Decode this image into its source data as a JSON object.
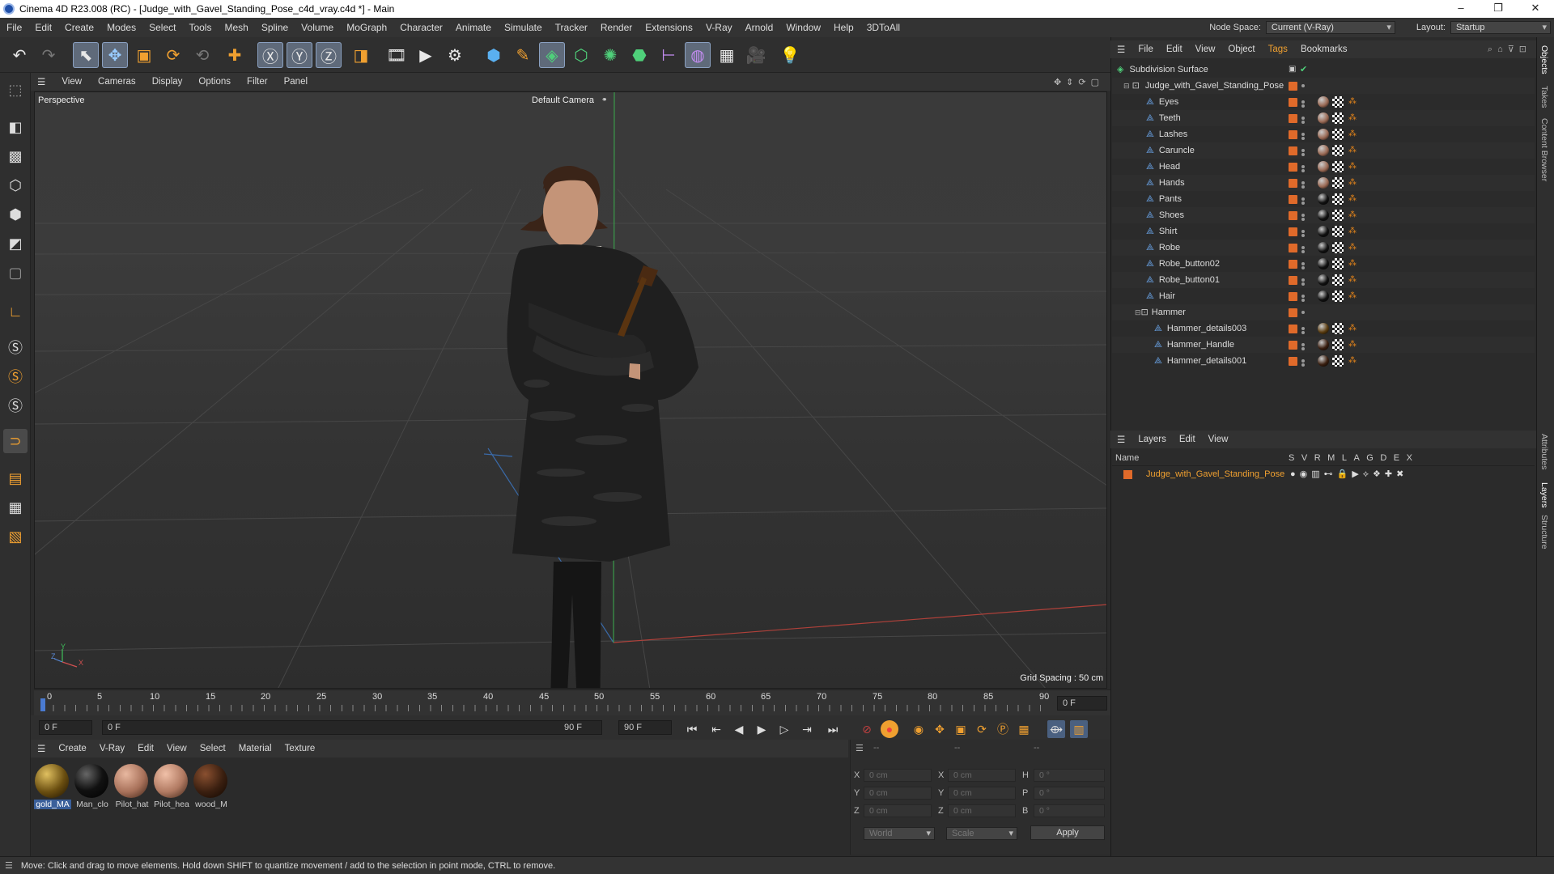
{
  "window": {
    "title": "Cinema 4D R23.008 (RC) - [Judge_with_Gavel_Standing_Pose_c4d_vray.c4d *] - Main",
    "controls": [
      "–",
      "❐",
      "✕"
    ]
  },
  "menubar": {
    "items": [
      "File",
      "Edit",
      "Create",
      "Modes",
      "Select",
      "Tools",
      "Mesh",
      "Spline",
      "Volume",
      "MoGraph",
      "Character",
      "Animate",
      "Simulate",
      "Tracker",
      "Render",
      "Extensions",
      "V-Ray",
      "Arnold",
      "Window",
      "Help",
      "3DToAll"
    ],
    "node_space_label": "Node Space:",
    "node_space_value": "Current (V-Ray)",
    "layout_label": "Layout:",
    "layout_value": "Startup"
  },
  "viewport": {
    "menu": [
      "View",
      "Cameras",
      "Display",
      "Options",
      "Filter",
      "Panel"
    ],
    "view_name": "Perspective",
    "camera": "Default Camera",
    "grid_spacing": "Grid Spacing : 50 cm",
    "axis_y": "Y",
    "axis_z": "Z",
    "axis_x": "X"
  },
  "timeline": {
    "ticks": [
      "0",
      "5",
      "10",
      "15",
      "20",
      "25",
      "30",
      "35",
      "40",
      "45",
      "50",
      "55",
      "60",
      "65",
      "70",
      "75",
      "80",
      "85",
      "90"
    ],
    "end_frame": "0 F",
    "current_start": "0 F",
    "slider_start": "0 F",
    "slider_end": "90 F",
    "max_frame": "90 F"
  },
  "materials": {
    "menu": [
      "Create",
      "V-Ray",
      "Edit",
      "View",
      "Select",
      "Material",
      "Texture"
    ],
    "items": [
      {
        "name": "gold_MA",
        "color": "#6a4e10"
      },
      {
        "name": "Man_clo",
        "color": "#111111"
      },
      {
        "name": "Pilot_hat",
        "color": "#a8715a"
      },
      {
        "name": "Pilot_hea",
        "color": "#b17a62"
      },
      {
        "name": "wood_M",
        "color": "#3a1f10"
      }
    ]
  },
  "attributes": {
    "header_left": "--",
    "header_mid": "--",
    "header_right": "--",
    "rows": [
      {
        "a": "X",
        "av": "0 cm",
        "b": "X",
        "bv": "0 cm",
        "c": "H",
        "cv": "0 °"
      },
      {
        "a": "Y",
        "av": "0 cm",
        "b": "Y",
        "bv": "0 cm",
        "c": "P",
        "cv": "0 °"
      },
      {
        "a": "Z",
        "av": "0 cm",
        "b": "Z",
        "bv": "0 cm",
        "c": "B",
        "cv": "0 °"
      }
    ],
    "coord_system": "World",
    "mode": "Scale",
    "apply_label": "Apply"
  },
  "objects": {
    "menu": [
      "File",
      "Edit",
      "View",
      "Object",
      "Tags",
      "Bookmarks"
    ],
    "root": "Subdivision Surface",
    "group": "Judge_with_Gavel_Standing_Pose",
    "children": [
      {
        "name": "Eyes",
        "tag": "#9a6a55"
      },
      {
        "name": "Teeth",
        "tag": "#9a6a55"
      },
      {
        "name": "Lashes",
        "tag": "#9a6a55"
      },
      {
        "name": "Caruncle",
        "tag": "#9a6a55"
      },
      {
        "name": "Head",
        "tag": "#9a6a55"
      },
      {
        "name": "Hands",
        "tag": "#9a6a55"
      },
      {
        "name": "Pants",
        "tag": "#111111"
      },
      {
        "name": "Shoes",
        "tag": "#111111"
      },
      {
        "name": "Shirt",
        "tag": "#111111"
      },
      {
        "name": "Robe",
        "tag": "#111111"
      },
      {
        "name": "Robe_button02",
        "tag": "#111111"
      },
      {
        "name": "Robe_button01",
        "tag": "#111111"
      },
      {
        "name": "Hair",
        "tag": "#111111"
      }
    ],
    "hammer": "Hammer",
    "hammer_children": [
      {
        "name": "Hammer_details003",
        "tag": "#5a3c10"
      },
      {
        "name": "Hammer_Handle",
        "tag": "#3a1f10"
      },
      {
        "name": "Hammer_details001",
        "tag": "#3a1f10"
      }
    ]
  },
  "layers": {
    "menu": [
      "Layers",
      "Edit",
      "View"
    ],
    "col_name": "Name",
    "cols": [
      "S",
      "V",
      "R",
      "M",
      "L",
      "A",
      "G",
      "D",
      "E",
      "X"
    ],
    "layer_name": "Judge_with_Gavel_Standing_Pose"
  },
  "sidetabs": [
    "Objects",
    "Takes",
    "Content Browser",
    "Attributes",
    "Layers",
    "Structure"
  ],
  "status": "Move: Click and drag to move elements. Hold down SHIFT to quantize movement / add to the selection in point mode, CTRL to remove."
}
